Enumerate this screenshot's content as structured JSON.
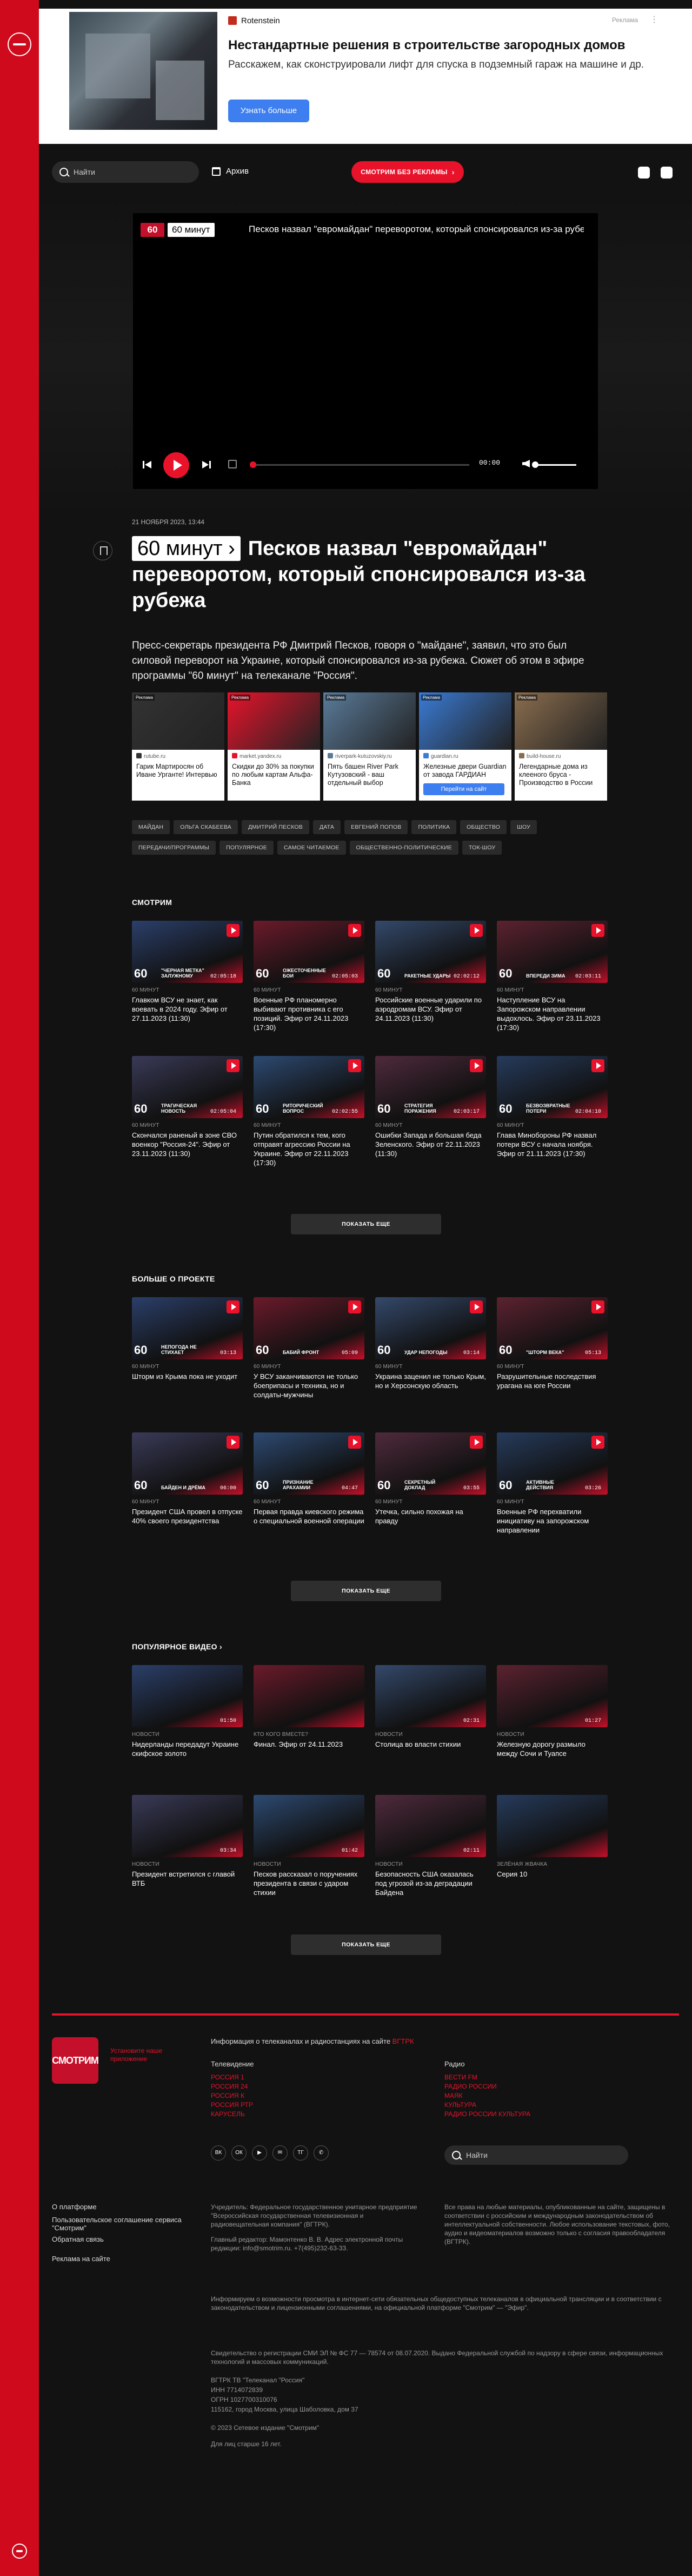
{
  "top_ad": {
    "brand": "Rotenstein",
    "label": "Реклама",
    "dots": "⋮",
    "title": "Нестандартные решения в строительстве загородных домов",
    "text": "Расскажем, как сконструировали лифт для спуска в подземный гараж на машине и др.",
    "button": "Узнать больше"
  },
  "header": {
    "search_placeholder": "Найти",
    "archive": "Архив",
    "watch_button": "СМОТРИМ БЕЗ РЕКЛАМЫ",
    "watch_chevron": "›"
  },
  "player": {
    "logo": "60",
    "badge": "60 минут",
    "title": "Песков назвал \"евромайдан\" переворотом, который спонсировался из-за рубежа",
    "time": "00:00"
  },
  "article": {
    "date": "21 НОЯБРЯ 2023, 13:44",
    "badge": "60 минут ›",
    "title": "Песков назвал \"евромайдан\" переворотом, который спонсировался из-за рубежа",
    "lead": "Пресс-секретарь президента РФ Дмитрий Песков, говоря о \"майдане\", заявил, что это был силовой переворот на Украине, который спонсировался из-за рубежа. Сюжет об этом в эфире программы \"60 минут\" на телеканале \"Россия\"."
  },
  "ad_cards": [
    {
      "tag": "Реклама",
      "src": "rutube.ru",
      "text": "Гарик Мартиросян об Иване Урганте! Интервью",
      "cta": "",
      "color": "#333"
    },
    {
      "tag": "Реклама",
      "src": "market.yandex.ru",
      "text": "Скидки до 30% за покупки по любым картам Альфа-Банка",
      "cta": "",
      "color": "#e8132b"
    },
    {
      "tag": "Реклама",
      "src": "riverpark-kutuzovskiy.ru",
      "text": "Пять башен River Park Кутузовский - ваш отдельный выбор",
      "cta": "",
      "color": "#5a7b9a"
    },
    {
      "tag": "Реклама",
      "src": "guardian.ru",
      "text": "Железные двери Guardian от завода ГАРДИАН",
      "cta": "Перейти на сайт",
      "color": "#3a7bd5"
    },
    {
      "tag": "Реклама",
      "src": "build-house.ru",
      "text": "Легендарные дома из клееного бруса - Производство в России",
      "cta": "",
      "color": "#8a6d4e"
    }
  ],
  "tags": [
    "МАЙДАН",
    "ОЛЬГА СКАБЕЕВА",
    "ДМИТРИЙ ПЕСКОВ",
    "ДАТА",
    "ЕВГЕНИЙ ПОПОВ",
    "ПОЛИТИКА",
    "ОБЩЕСТВО",
    "ШОУ",
    "ПЕРЕДАЧИ/ПРОГРАММЫ",
    "ПОПУЛЯРНОЕ",
    "САМОЕ ЧИТАЕМОЕ",
    "ОБЩЕСТВЕННО-ПОЛИТИЧЕСКИЕ",
    "ТОК-ШОУ"
  ],
  "watch": {
    "title": "СМОТРИМ",
    "more": "ПОКАЗАТЬ ЕЩЕ",
    "items": [
      {
        "label": "60 МИНУТ",
        "title": "Главком ВСУ не знает, как воевать в 2024 году. Эфир от 27.11.2023 (11:30)",
        "cap": "\"ЧЕРНАЯ МЕТКА\" ЗАЛУЖНОМУ",
        "dur": "02:05:18"
      },
      {
        "label": "60 МИНУТ",
        "title": "Военные РФ планомерно выбивают противника с его позиций. Эфир от 24.11.2023 (17:30)",
        "cap": "ОЖЕСТОЧЕННЫЕ БОИ",
        "dur": "02:05:03"
      },
      {
        "label": "60 МИНУТ",
        "title": "Российские военные ударили по аэродромам ВСУ. Эфир от 24.11.2023 (11:30)",
        "cap": "РАКЕТНЫЕ УДАРЫ",
        "dur": "02:02:12"
      },
      {
        "label": "60 МИНУТ",
        "title": "Наступление ВСУ на Запорожском направлении выдохлось. Эфир от 23.11.2023 (17:30)",
        "cap": "ВПЕРЕДИ ЗИМА",
        "dur": "02:03:11"
      },
      {
        "label": "60 МИНУТ",
        "title": "Скончался раненый в зоне СВО военкор \"Россия-24\". Эфир от 23.11.2023 (11:30)",
        "cap": "ТРАГИЧЕСКАЯ НОВОСТЬ",
        "dur": "02:05:04"
      },
      {
        "label": "60 МИНУТ",
        "title": "Путин обратился к тем, кого отправят агрессию России на Украине. Эфир от 22.11.2023 (17:30)",
        "cap": "РИТОРИЧЕСКИЙ ВОПРОС",
        "dur": "02:02:55"
      },
      {
        "label": "60 МИНУТ",
        "title": "Ошибки Запада и большая беда Зеленского. Эфир от 22.11.2023 (11:30)",
        "cap": "СТРАТЕГИЯ ПОРАЖЕНИЯ",
        "dur": "02:03:17"
      },
      {
        "label": "60 МИНУТ",
        "title": "Глава Минобороны РФ назвал потери ВСУ с начала ноября. Эфир от 21.11.2023 (17:30)",
        "cap": "БЕЗВОЗВРАТНЫЕ ПОТЕРИ",
        "dur": "02:04:10"
      }
    ]
  },
  "project": {
    "title": "БОЛЬШЕ О ПРОЕКТЕ",
    "more": "ПОКАЗАТЬ ЕЩЕ",
    "items": [
      {
        "label": "60 МИНУТ",
        "title": "Шторм из Крыма пока не уходит",
        "cap": "НЕПОГОДА НЕ СТИХАЕТ",
        "dur": "03:13"
      },
      {
        "label": "60 МИНУТ",
        "title": "У ВСУ заканчиваются не только боеприпасы и техника, но и солдаты-мужчины",
        "cap": "БАБИЙ ФРОНТ",
        "dur": "05:09"
      },
      {
        "label": "60 МИНУТ",
        "title": "Украина заценил не только Крым, но и Херсонскую область",
        "cap": "УДАР НЕПОГОДЫ",
        "dur": "03:14"
      },
      {
        "label": "60 МИНУТ",
        "title": "Разрушительные последствия урагана на юге России",
        "cap": "\"ШТОРМ ВЕКА\"",
        "dur": "05:13"
      },
      {
        "label": "60 МИНУТ",
        "title": "Президент США провел в отпуске 40% своего президентства",
        "cap": "БАЙДЕН И ДРЁМА",
        "dur": "06:00"
      },
      {
        "label": "60 МИНУТ",
        "title": "Первая правда киевского режима о специальной военной операции",
        "cap": "ПРИЗНАНИЕ АРАХАМИИ",
        "dur": "04:47"
      },
      {
        "label": "60 МИНУТ",
        "title": "Утечка, сильно похожая на правду",
        "cap": "СЕКРЕТНЫЙ ДОКЛАД",
        "dur": "03:55"
      },
      {
        "label": "60 МИНУТ",
        "title": "Военные РФ перехватили инициативу на запорожском направлении",
        "cap": "АКТИВНЫЕ ДЕЙСТВИЯ",
        "dur": "03:26"
      }
    ]
  },
  "popular": {
    "title": "ПОПУЛЯРНОЕ ВИДЕО ›",
    "more": "ПОКАЗАТЬ ЕЩЕ",
    "items": [
      {
        "label": "НОВОСТИ",
        "title": "Нидерланды передадут Украине скифское золото",
        "dur": "01:50"
      },
      {
        "label": "КТО КОГО ВМЕСТЕ?",
        "title": "Финал. Эфир от 24.11.2023",
        "dur": ""
      },
      {
        "label": "НОВОСТИ",
        "title": "Столица во власти стихии",
        "dur": "02:31"
      },
      {
        "label": "НОВОСТИ",
        "title": "Железную дорогу размыло между Сочи и Туапсе",
        "dur": "01:27"
      },
      {
        "label": "НОВОСТИ",
        "title": "Президент встретился с главой ВТБ",
        "dur": "03:34"
      },
      {
        "label": "НОВОСТИ",
        "title": "Песков рассказал о поручениях президента в связи с ударом стихии",
        "dur": "01:42"
      },
      {
        "label": "НОВОСТИ",
        "title": "Безопасность США оказалась под угрозой из-за деградации Байдена",
        "dur": "02:11"
      },
      {
        "label": "ЗЕЛЁНАЯ ЖВАЧКА",
        "title": "Серия 10",
        "dur": ""
      }
    ]
  },
  "footer": {
    "logo": "СМОТРИМ",
    "logo_text": "Установите наше приложение",
    "info": "Информация о телеканалах и радиостанциях на сайте",
    "info_link": "ВГТРК",
    "tv_title": "Телевидение",
    "tv_links": [
      "РОССИЯ 1",
      "РОССИЯ 24",
      "РОССИЯ К",
      "РОССИЯ РТР",
      "КАРУСЕЛЬ"
    ],
    "radio_title": "Радио",
    "radio_links": [
      "ВЕСТИ FM",
      "РАДИО РОССИИ",
      "МАЯК",
      "КУЛЬТУРА",
      "РАДИО РОССИИ КУЛЬТУРА"
    ],
    "socials": [
      "ВК",
      "ОК",
      "▶",
      "✉",
      "ТГ",
      "✆"
    ],
    "search_placeholder": "Найти",
    "nav": [
      "О платформе",
      "Пользовательское соглашение сервиса \"Смотрим\"",
      "Обратная связь",
      "Реклама на сайте"
    ],
    "founder": "Учредитель: Федеральное государственное унитарное предприятие \"Всероссийская государственная телевизионная и радиовещательная компания\" (ВГТРК).",
    "editor": "Главный редактор: Мамонтенко В. В. Адрес электронной почты редакции: info@smotrim.ru. +7(495)232-63-33.",
    "rights": "Все права на любые материалы, опубликованные на сайте, защищены в соответствии с российским и международным законодательством об интеллектуальной собственности. Любое использование текстовых, фото, аудио и видеоматериалов возможно только с согласия правообладателя (ВГТРК).",
    "license": "Информируем о возможности просмотра в интернет-сети обязательных общедоступных телеканалов в официальной трансляции и в соответствии с законодательством и лицензионными соглашениями, на официальной платформе \"Смотрим\" — \"Эфир\".",
    "registration": "Свидетельство о регистрации СМИ ЭЛ № ФС 77 — 78574 от 08.07.2020. Выдано Федеральной службой по надзору в сфере связи, информационных технологий и массовых коммуникаций.",
    "legal": "ВГТРК ТВ \"Телеканал \"Россия\"",
    "inn": "ИНН 7714072839",
    "ogrn": "ОГРН 1027700310076",
    "address": "115162, город Москва, улица Шаболовка, дом 37",
    "age": "Для лиц старше 16 лет.",
    "copyright": "© 2023 Сетевое издание \"Смотрим\""
  },
  "colors": {
    "accent": "#e8132b",
    "sidebar": "#cf0a1c",
    "bg": "#121212"
  }
}
